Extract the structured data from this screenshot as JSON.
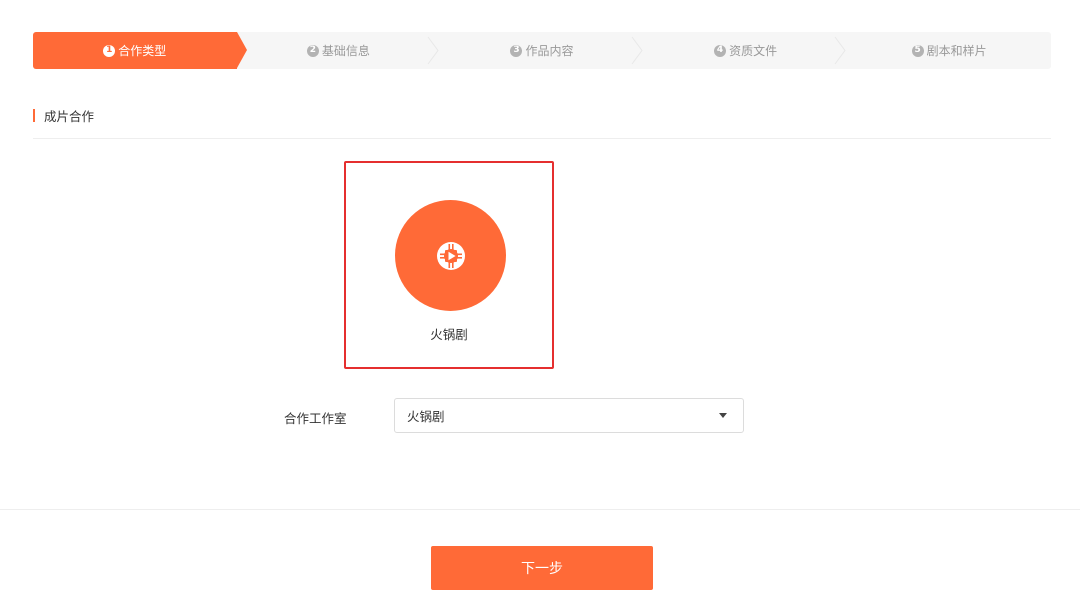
{
  "stepper": {
    "steps": [
      {
        "number": "1",
        "label": "合作类型",
        "active": true
      },
      {
        "number": "2",
        "label": "基础信息",
        "active": false
      },
      {
        "number": "3",
        "label": "作品内容",
        "active": false
      },
      {
        "number": "4",
        "label": "资质文件",
        "active": false
      },
      {
        "number": "5",
        "label": "剧本和样片",
        "active": false
      }
    ]
  },
  "section": {
    "title": "成片合作"
  },
  "type_card": {
    "label": "火锅剧",
    "icon": "film-play-icon",
    "selected": true
  },
  "form": {
    "studio_label": "合作工作室",
    "studio_value": "火锅剧"
  },
  "actions": {
    "next_label": "下一步"
  },
  "colors": {
    "accent": "#ff6a37",
    "selection_border": "#e52f2f",
    "inactive_text": "#999999"
  }
}
